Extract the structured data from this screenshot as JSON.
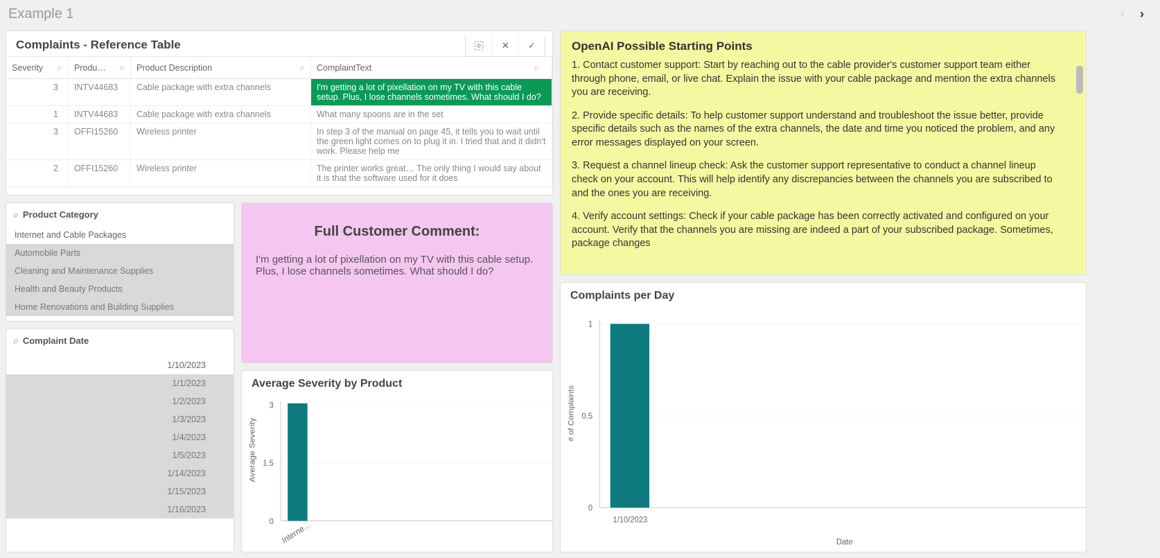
{
  "header": {
    "title": "Example 1"
  },
  "complaints_panel": {
    "title": "Complaints - Reference Table",
    "columns": {
      "severity": "Severity",
      "product": "Produ…",
      "description": "Product Description",
      "complaint": "ComplaintText"
    },
    "rows": [
      {
        "severity": "3",
        "product": "INTV44683",
        "description": "Cable package with extra channels",
        "complaint": "I'm getting a lot of pixellation on my TV with this cable setup. Plus, I lose channels sometimes. What should I do?",
        "selected": true
      },
      {
        "severity": "1",
        "product": "INTV44683",
        "description": "Cable package with extra channels",
        "complaint": "What many spoons are in the set",
        "selected": false
      },
      {
        "severity": "3",
        "product": "OFFI15260",
        "description": "Wireless printer",
        "complaint": "In step 3 of the manual on page 45, it tells you to wait until the green light comes on to plug it in. I tried that and it didn't work. Please help me",
        "selected": false
      },
      {
        "severity": "2",
        "product": "OFFI15260",
        "description": "Wireless printer",
        "complaint": "The printer works great… The only thing I would say about it is that the software used for it does",
        "selected": false
      }
    ]
  },
  "product_category": {
    "title": "Product Category",
    "items": [
      {
        "label": "Internet and Cable Packages",
        "selected": true
      },
      {
        "label": "Automobile Parts",
        "selected": false
      },
      {
        "label": "Cleaning and Maintenance Supplies",
        "selected": false
      },
      {
        "label": "Health and Beauty Products",
        "selected": false
      },
      {
        "label": "Home Renovations and Building Supplies",
        "selected": false
      }
    ]
  },
  "complaint_date": {
    "title": "Complaint Date",
    "items": [
      {
        "label": "1/10/2023",
        "selected": true
      },
      {
        "label": "1/1/2023",
        "selected": false
      },
      {
        "label": "1/2/2023",
        "selected": false
      },
      {
        "label": "1/3/2023",
        "selected": false
      },
      {
        "label": "1/4/2023",
        "selected": false
      },
      {
        "label": "1/5/2023",
        "selected": false
      },
      {
        "label": "1/14/2023",
        "selected": false
      },
      {
        "label": "1/15/2023",
        "selected": false
      },
      {
        "label": "1/16/2023",
        "selected": false
      }
    ]
  },
  "comment_panel": {
    "title": "Full Customer Comment:",
    "body": "I'm getting a lot of pixellation on my TV with this cable setup. Plus, I lose channels sometimes. What should I do?"
  },
  "openai_panel": {
    "title": "OpenAI Possible Starting Points",
    "paragraphs": [
      "1. Contact customer support: Start by reaching out to the cable provider's customer support team either through phone, email, or live chat. Explain the issue with your cable package and mention the extra channels you are receiving.",
      "2. Provide specific details: To help customer support understand and troubleshoot the issue better, provide specific details such as the names of the extra channels, the date and time you noticed the problem, and any error messages displayed on your screen.",
      "3. Request a channel lineup check: Ask the customer support representative to conduct a channel lineup check on your account. This will help identify any discrepancies between the channels you are subscribed to and the ones you are receiving.",
      "4. Verify account settings: Check if your cable package has been correctly activated and configured on your account. Verify that the channels you are missing are indeed a part of your subscribed package. Sometimes, package changes"
    ]
  },
  "sev_chart": {
    "title": "Average Severity by Product",
    "ylabel": "Average Severity"
  },
  "cpd_chart": {
    "title": "Complaints per Day",
    "ylabel": "# of Complaints",
    "xlabel": "Date"
  },
  "chart_data": [
    {
      "type": "bar",
      "title": "Average Severity by Product",
      "xlabel": "",
      "ylabel": "Average Severity",
      "categories": [
        "Interne…"
      ],
      "values": [
        3.05
      ],
      "ylim": [
        0,
        3
      ],
      "yticks": [
        0,
        1.5,
        3
      ]
    },
    {
      "type": "bar",
      "title": "Complaints per Day",
      "xlabel": "Date",
      "ylabel": "# of Complaints",
      "categories": [
        "1/10/2023"
      ],
      "values": [
        1
      ],
      "ylim": [
        0,
        1
      ],
      "yticks": [
        0,
        0.5,
        1
      ]
    }
  ]
}
